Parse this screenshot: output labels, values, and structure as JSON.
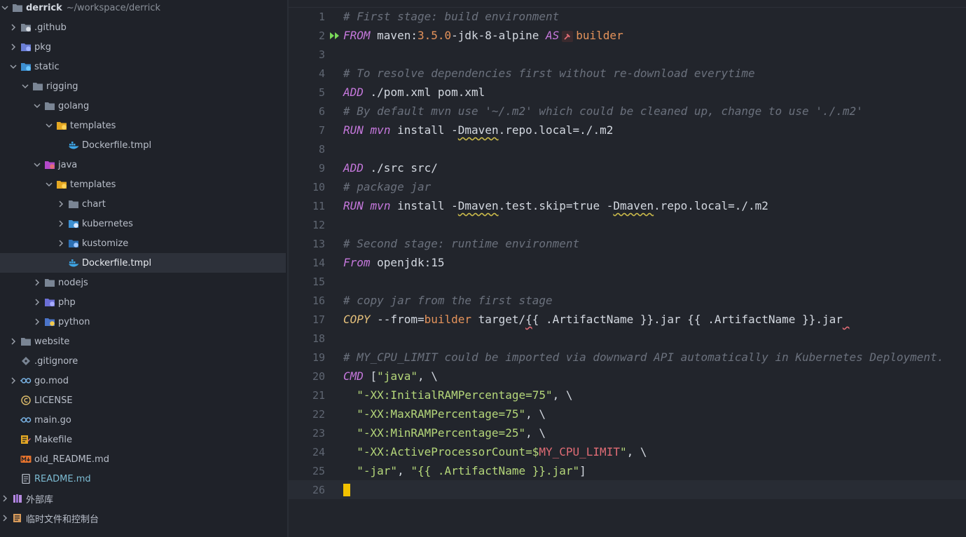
{
  "sidebar": {
    "root": {
      "name": "derrick",
      "path": "~/workspace/derrick"
    },
    "items": [
      {
        "label": ".github",
        "depth": 1,
        "arrow": "right",
        "icon": "github-folder-icon"
      },
      {
        "label": "pkg",
        "depth": 1,
        "arrow": "right",
        "icon": "package-folder-icon"
      },
      {
        "label": "static",
        "depth": 1,
        "arrow": "down",
        "icon": "static-folder-icon"
      },
      {
        "label": "rigging",
        "depth": 2,
        "arrow": "down",
        "icon": "folder-icon"
      },
      {
        "label": "golang",
        "depth": 3,
        "arrow": "down",
        "icon": "folder-icon"
      },
      {
        "label": "templates",
        "depth": 4,
        "arrow": "down",
        "icon": "templates-folder-icon"
      },
      {
        "label": "Dockerfile.tmpl",
        "depth": 5,
        "arrow": "none",
        "icon": "docker-icon"
      },
      {
        "label": "java",
        "depth": 3,
        "arrow": "down",
        "icon": "java-folder-icon"
      },
      {
        "label": "templates",
        "depth": 4,
        "arrow": "down",
        "icon": "templates-folder-icon"
      },
      {
        "label": "chart",
        "depth": 5,
        "arrow": "right",
        "icon": "folder-icon"
      },
      {
        "label": "kubernetes",
        "depth": 5,
        "arrow": "right",
        "icon": "kubernetes-folder-icon"
      },
      {
        "label": "kustomize",
        "depth": 5,
        "arrow": "right",
        "icon": "kustomize-folder-icon"
      },
      {
        "label": "Dockerfile.tmpl",
        "depth": 5,
        "arrow": "none",
        "icon": "docker-icon",
        "selected": true
      },
      {
        "label": "nodejs",
        "depth": 3,
        "arrow": "right",
        "icon": "folder-icon"
      },
      {
        "label": "php",
        "depth": 3,
        "arrow": "right",
        "icon": "php-folder-icon"
      },
      {
        "label": "python",
        "depth": 3,
        "arrow": "right",
        "icon": "python-folder-icon"
      },
      {
        "label": "website",
        "depth": 1,
        "arrow": "right",
        "icon": "folder-icon"
      },
      {
        "label": ".gitignore",
        "depth": 1,
        "arrow": "none",
        "icon": "git-icon"
      },
      {
        "label": "go.mod",
        "depth": 1,
        "arrow": "right",
        "icon": "go-icon"
      },
      {
        "label": "LICENSE",
        "depth": 1,
        "arrow": "none",
        "icon": "license-icon"
      },
      {
        "label": "main.go",
        "depth": 1,
        "arrow": "none",
        "icon": "go-icon"
      },
      {
        "label": "Makefile",
        "depth": 1,
        "arrow": "none",
        "icon": "makefile-icon"
      },
      {
        "label": "old_README.md",
        "depth": 1,
        "arrow": "none",
        "icon": "markdown-icon"
      },
      {
        "label": "README.md",
        "depth": 1,
        "arrow": "none",
        "icon": "readme-icon",
        "readme": true
      },
      {
        "label": "外部库",
        "depth": 0,
        "arrow": "right",
        "icon": "library-icon"
      },
      {
        "label": "临时文件和控制台",
        "depth": 0,
        "arrow": "right",
        "icon": "scratch-icon"
      }
    ]
  },
  "editor": {
    "current_line": 26,
    "lines": [
      {
        "n": "1",
        "tokens": [
          {
            "t": "# First stage: build environment",
            "c": "comment"
          }
        ]
      },
      {
        "n": "2",
        "run": true,
        "tokens": [
          {
            "t": "FROM",
            "c": "kw"
          },
          {
            "t": " maven:",
            "c": "plain"
          },
          {
            "t": "3.5.0",
            "c": "num"
          },
          {
            "t": "-jdk-8-alpine ",
            "c": "plain"
          },
          {
            "t": "AS",
            "c": "kw"
          },
          {
            "t": "",
            "c": "hammer"
          },
          {
            "t": "builder",
            "c": "num"
          }
        ]
      },
      {
        "n": "3",
        "tokens": []
      },
      {
        "n": "4",
        "tokens": [
          {
            "t": "# To resolve dependencies first without re-download everytime",
            "c": "comment"
          }
        ]
      },
      {
        "n": "5",
        "tokens": [
          {
            "t": "ADD",
            "c": "kw"
          },
          {
            "t": " ./pom.xml pom.xml",
            "c": "plain"
          }
        ]
      },
      {
        "n": "6",
        "tokens": [
          {
            "t": "# By default mvn use '~/.m2' which could be cleaned up, change to use './.m2'",
            "c": "comment"
          }
        ]
      },
      {
        "n": "7",
        "tokens": [
          {
            "t": "RUN",
            "c": "kw"
          },
          {
            "t": " ",
            "c": "plain"
          },
          {
            "t": "mvn",
            "c": "kw"
          },
          {
            "t": " install -",
            "c": "plain"
          },
          {
            "t": "Dmaven",
            "c": "wavy"
          },
          {
            "t": ".repo.local=./.m2",
            "c": "plain"
          }
        ]
      },
      {
        "n": "8",
        "tokens": []
      },
      {
        "n": "9",
        "tokens": [
          {
            "t": "ADD",
            "c": "kw"
          },
          {
            "t": " ./src src/",
            "c": "plain"
          }
        ]
      },
      {
        "n": "10",
        "tokens": [
          {
            "t": "# package jar",
            "c": "comment"
          }
        ]
      },
      {
        "n": "11",
        "tokens": [
          {
            "t": "RUN",
            "c": "kw"
          },
          {
            "t": " ",
            "c": "plain"
          },
          {
            "t": "mvn",
            "c": "kw"
          },
          {
            "t": " install -",
            "c": "plain"
          },
          {
            "t": "Dmaven",
            "c": "wavy"
          },
          {
            "t": ".test.skip=true -",
            "c": "plain"
          },
          {
            "t": "Dmaven",
            "c": "wavy"
          },
          {
            "t": ".repo.local=./.m2",
            "c": "plain"
          }
        ]
      },
      {
        "n": "12",
        "tokens": []
      },
      {
        "n": "13",
        "tokens": [
          {
            "t": "# Second stage: runtime environment",
            "c": "comment"
          }
        ]
      },
      {
        "n": "14",
        "tokens": [
          {
            "t": "From",
            "c": "kw"
          },
          {
            "t": " openjdk:15",
            "c": "plain"
          }
        ]
      },
      {
        "n": "15",
        "tokens": []
      },
      {
        "n": "16",
        "tokens": [
          {
            "t": "# copy jar from the first stage",
            "c": "comment"
          }
        ]
      },
      {
        "n": "17",
        "tokens": [
          {
            "t": "COPY",
            "c": "ws"
          },
          {
            "t": " --from=",
            "c": "plain"
          },
          {
            "t": "builder",
            "c": "num"
          },
          {
            "t": " target/",
            "c": "plain"
          },
          {
            "t": "{",
            "c": "wavyred"
          },
          {
            "t": "{ .ArtifactName }}.jar {{ .ArtifactName }}.jar",
            "c": "plain"
          },
          {
            "t": " ",
            "c": "wavyred"
          }
        ]
      },
      {
        "n": "18",
        "tokens": []
      },
      {
        "n": "19",
        "tokens": [
          {
            "t": "# MY_CPU_LIMIT could be imported via downward API automatically in Kubernetes Deployment.",
            "c": "comment"
          }
        ]
      },
      {
        "n": "20",
        "tokens": [
          {
            "t": "CMD",
            "c": "kw"
          },
          {
            "t": " [",
            "c": "plain"
          },
          {
            "t": "\"java\"",
            "c": "str"
          },
          {
            "t": ", \\",
            "c": "plain"
          }
        ]
      },
      {
        "n": "21",
        "tokens": [
          {
            "t": "  ",
            "c": "plain"
          },
          {
            "t": "\"-XX:InitialRAMPercentage=75\"",
            "c": "str"
          },
          {
            "t": ", \\",
            "c": "plain"
          }
        ]
      },
      {
        "n": "22",
        "tokens": [
          {
            "t": "  ",
            "c": "plain"
          },
          {
            "t": "\"-XX:MaxRAMPercentage=75\"",
            "c": "str"
          },
          {
            "t": ", \\",
            "c": "plain"
          }
        ]
      },
      {
        "n": "23",
        "tokens": [
          {
            "t": "  ",
            "c": "plain"
          },
          {
            "t": "\"-XX:MinRAMPercentage=25\"",
            "c": "str"
          },
          {
            "t": ", \\",
            "c": "plain"
          }
        ]
      },
      {
        "n": "24",
        "tokens": [
          {
            "t": "  ",
            "c": "plain"
          },
          {
            "t": "\"-XX:ActiveProcessorCount=$",
            "c": "str"
          },
          {
            "t": "MY_CPU_LIMIT",
            "c": "var"
          },
          {
            "t": "\"",
            "c": "str"
          },
          {
            "t": ", \\",
            "c": "plain"
          }
        ]
      },
      {
        "n": "25",
        "tokens": [
          {
            "t": "  ",
            "c": "plain"
          },
          {
            "t": "\"-jar\"",
            "c": "str"
          },
          {
            "t": ", ",
            "c": "plain"
          },
          {
            "t": "\"{{ .ArtifactName }}.jar\"",
            "c": "str"
          },
          {
            "t": "]",
            "c": "plain"
          }
        ]
      },
      {
        "n": "26",
        "cursor": true,
        "tokens": []
      }
    ]
  },
  "colors": {
    "sidebar_bg": "#1f2229",
    "editor_bg": "#22252c",
    "selection": "#2d313a",
    "cursor": "#f2c200",
    "keyword": "#c678dd",
    "string": "#b5d77a",
    "comment": "#6b717d"
  }
}
